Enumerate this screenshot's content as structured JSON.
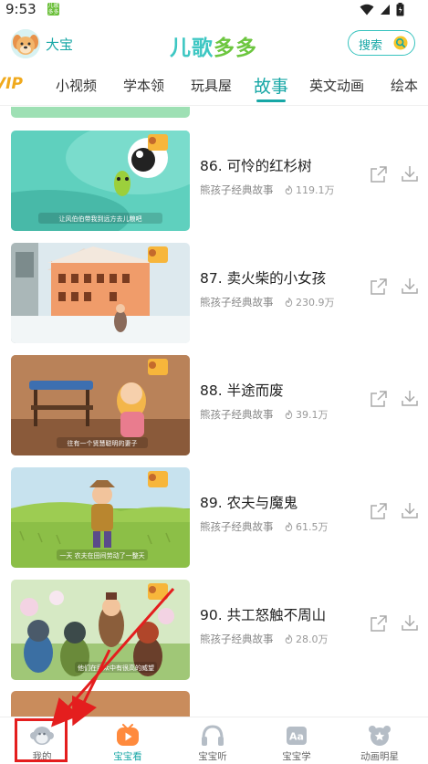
{
  "status_bar": {
    "time": "9:53",
    "app_icon_text": "儿歌多多"
  },
  "header": {
    "user_name": "大宝",
    "logo_chars": [
      "儿",
      "歌",
      "多",
      "多"
    ],
    "search_label": "搜索"
  },
  "tabs": {
    "vip_label": "VIP",
    "items": [
      "小视频",
      "学本领",
      "玩具屋",
      "故事",
      "英文动画",
      "绘本"
    ],
    "active_index": 3
  },
  "list": {
    "items": [
      {
        "title": "86. 可怜的红杉树",
        "series": "熊孩子经典故事",
        "plays": "119.1万",
        "caption": "让风伯伯带我到远方去儿粮吧"
      },
      {
        "title": "87. 卖火柴的小女孩",
        "series": "熊孩子经典故事",
        "plays": "230.9万",
        "caption": ""
      },
      {
        "title": "88. 半途而废",
        "series": "熊孩子经典故事",
        "plays": "39.1万",
        "caption": "往有一个贤慧聪明的妻子"
      },
      {
        "title": "89. 农夫与魔鬼",
        "series": "熊孩子经典故事",
        "plays": "61.5万",
        "caption": "一天 农夫在田间劳动了一整天"
      },
      {
        "title": "90. 共工怒触不周山",
        "series": "熊孩子经典故事",
        "plays": "28.0万",
        "caption": "他们在民众中有很高的威望"
      }
    ],
    "thumb_badge": "熊孩子"
  },
  "bottom_nav": {
    "items": [
      {
        "label": "我的",
        "icon": "monkey-avatar-icon"
      },
      {
        "label": "宝宝看",
        "icon": "play-tv-icon"
      },
      {
        "label": "宝宝听",
        "icon": "headphones-icon"
      },
      {
        "label": "宝宝学",
        "icon": "letters-aa-icon"
      },
      {
        "label": "动画明星",
        "icon": "bear-star-icon"
      }
    ],
    "active_index": 1
  },
  "colors": {
    "accent": "#17a7a6",
    "annotation": "#e41e1e",
    "vip": "#f0a91c"
  }
}
